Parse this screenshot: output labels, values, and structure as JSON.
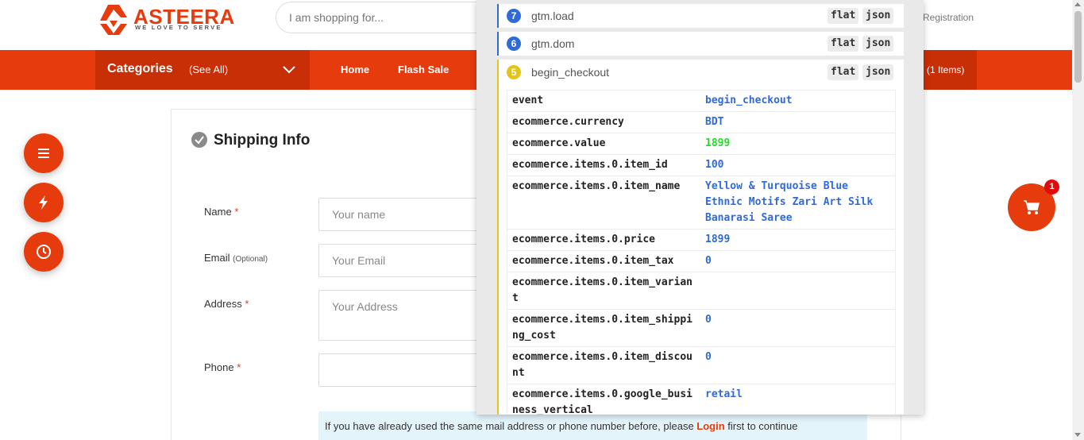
{
  "header": {
    "logo_text": "ASTEERA",
    "logo_tagline": "WE LOVE TO SERVE",
    "search_placeholder": "I am shopping for...",
    "registration": "Registration"
  },
  "nav": {
    "categories": "Categories",
    "see_all": "(See All)",
    "links": [
      "Home",
      "Flash Sale"
    ],
    "cart": "(1 Items)"
  },
  "shipping": {
    "title": "Shipping Info",
    "fields": [
      {
        "label": "Name",
        "required": "*",
        "optional": "",
        "placeholder": "Your name"
      },
      {
        "label": "Email",
        "required": "",
        "optional": "(Optional)",
        "placeholder": "Your Email"
      },
      {
        "label": "Address",
        "required": "*",
        "optional": "",
        "placeholder": "Your Address"
      },
      {
        "label": "Phone",
        "required": "*",
        "optional": "",
        "placeholder": ""
      }
    ],
    "notice_before": "If you have already used the same mail address or phone number before, please ",
    "notice_link": "Login",
    "notice_after": " first to continue"
  },
  "cart_badge": "1",
  "gtm": {
    "tags": {
      "flat": "flat",
      "json": "json"
    },
    "events": [
      {
        "num": "7",
        "name": "gtm.load"
      },
      {
        "num": "6",
        "name": "gtm.dom"
      },
      {
        "num": "5",
        "name": "begin_checkout"
      }
    ],
    "rows": [
      {
        "key": "event",
        "value": "begin_checkout"
      },
      {
        "key": "ecommerce.currency",
        "value": "BDT"
      },
      {
        "key": "ecommerce.value",
        "value": "1899"
      },
      {
        "key": "ecommerce.items.0.item_id",
        "value": "100"
      },
      {
        "key": "ecommerce.items.0.item_name",
        "value": "Yellow & Turquoise Blue Ethnic Motifs Zari Art Silk Banarasi Saree"
      },
      {
        "key": "ecommerce.items.0.price",
        "value": "1899"
      },
      {
        "key": "ecommerce.items.0.item_tax",
        "value": "0"
      },
      {
        "key": "ecommerce.items.0.item_variant",
        "value": ""
      },
      {
        "key": "ecommerce.items.0.item_shipping_cost",
        "value": "0"
      },
      {
        "key": "ecommerce.items.0.item_discount",
        "value": "0"
      },
      {
        "key": "ecommerce.items.0.google_business_vertical",
        "value": "retail"
      }
    ]
  },
  "colors": {
    "brand": "#e53b0d",
    "brand_dark": "#c92f06",
    "gtm_blue": "#2f6bd8",
    "gtm_yellow": "#e4c31b"
  }
}
